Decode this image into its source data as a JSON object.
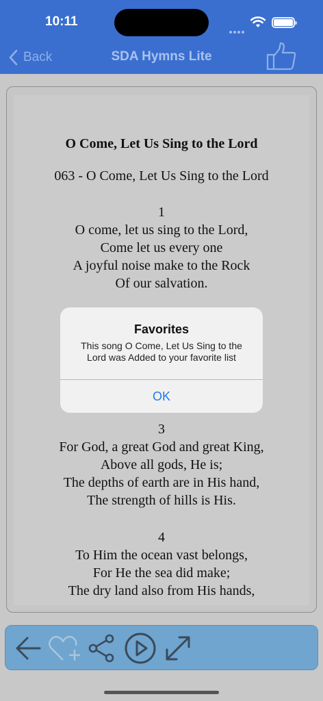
{
  "status": {
    "time": "10:11"
  },
  "nav": {
    "back_label": "Back",
    "title": "SDA Hymns Lite",
    "like_icon": "thumbs-up-icon"
  },
  "song": {
    "title": "O Come, Let Us Sing to the Lord",
    "subtitle": "063 - O Come, Let Us Sing to the Lord",
    "verses": [
      {
        "number": "1",
        "lines": [
          "O come, let us sing to the Lord,",
          "Come let us every one",
          "A joyful noise make to the Rock",
          "Of our salvation."
        ]
      },
      {
        "number": "3",
        "lines": [
          "For God, a great God and great King,",
          "Above all gods, He is;",
          "The depths of earth are in His hand,",
          "The strength of hills is His."
        ]
      },
      {
        "number": "4",
        "lines": [
          "To Him the ocean vast belongs,",
          "For He the sea did make;",
          "The dry land also from His hands,"
        ]
      }
    ]
  },
  "alert": {
    "title": "Favorites",
    "message": "This song O Come, Let Us Sing to the Lord was Added to your favorite list",
    "ok_label": "OK"
  },
  "toolbar": {
    "icons": [
      "arrow-left-icon",
      "heart-plus-icon",
      "share-icon",
      "play-icon",
      "expand-icon"
    ]
  },
  "colors": {
    "header": "#3a6fd0",
    "toolbar": "#6fa5cf",
    "alert_button": "#1f7ae8"
  }
}
